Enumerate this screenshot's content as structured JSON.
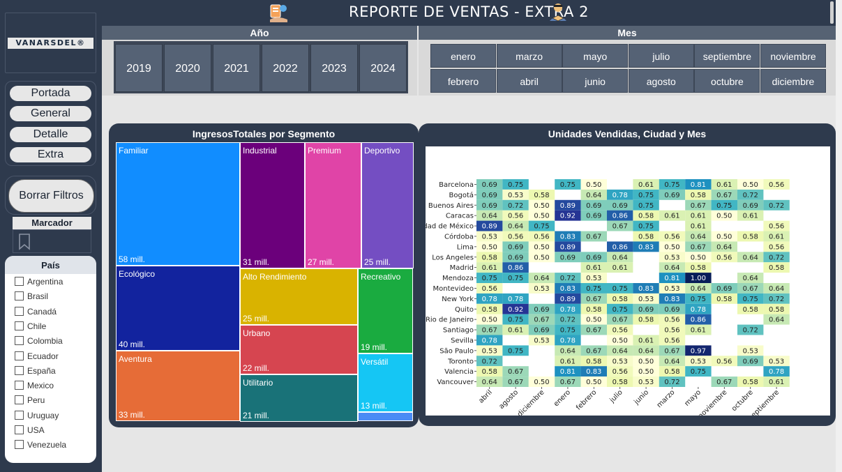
{
  "header": {
    "title": "REPORTE DE VENTAS - EXTRA 2",
    "left_icon": "sales-report-icon",
    "right_icon": "handshake-icon"
  },
  "logo": {
    "text": "VANARSDEL®"
  },
  "nav": {
    "items": [
      {
        "label": "Portada"
      },
      {
        "label": "General"
      },
      {
        "label": "Detalle"
      },
      {
        "label": "Extra"
      }
    ]
  },
  "clear_filters": {
    "label": "Borrar Filtros"
  },
  "bookmark": {
    "title": "Marcador",
    "icon": "bookmark-icon"
  },
  "country_filter": {
    "title": "País",
    "items": [
      "Argentina",
      "Brasil",
      "Canadá",
      "Chile",
      "Colombia",
      "Ecuador",
      "España",
      "Mexico",
      "Peru",
      "Uruguay",
      "USA",
      "Venezuela"
    ]
  },
  "year_slicer": {
    "title": "Año",
    "years": [
      "2019",
      "2020",
      "2021",
      "2022",
      "2023",
      "2024"
    ]
  },
  "month_slicer": {
    "title": "Mes",
    "row1": [
      "enero",
      "marzo",
      "mayo",
      "julio",
      "septiembre",
      "noviembre"
    ],
    "row2": [
      "febrero",
      "abril",
      "junio",
      "agosto",
      "octubre",
      "diciembre"
    ]
  },
  "colors": {
    "panel": "#2e3a4d",
    "slicer_button": "#556275",
    "background": "#e6e6e6"
  },
  "chart_data": [
    {
      "type": "treemap",
      "title": "IngresosTotales por Segmento",
      "unit": "mill.",
      "segments": [
        {
          "name": "Familiar",
          "value": 58,
          "label": "58 mill.",
          "color": "#118dff"
        },
        {
          "name": "Industrial",
          "value": 31,
          "label": "31 mill.",
          "color": "#6b007b"
        },
        {
          "name": "Premium",
          "value": 27,
          "label": "27 mill.",
          "color": "#e044a7"
        },
        {
          "name": "Deportivo",
          "value": 25,
          "label": "25 mill.",
          "color": "#744ec2"
        },
        {
          "name": "Ecológico",
          "value": 40,
          "label": "40 mill.",
          "color": "#12239e"
        },
        {
          "name": "Alto Rendimiento",
          "value": 25,
          "label": "25 mill.",
          "color": "#d9b300"
        },
        {
          "name": "Recreativo",
          "value": 19,
          "label": "19 mill.",
          "color": "#1aab40"
        },
        {
          "name": "Aventura",
          "value": 33,
          "label": "33 mill.",
          "color": "#e66c37"
        },
        {
          "name": "Urbano",
          "value": 22,
          "label": "22 mill.",
          "color": "#d64550"
        },
        {
          "name": "Versátil",
          "value": 13,
          "label": "13 mill.",
          "color": "#15c6f4"
        },
        {
          "name": "Utilitario",
          "value": 21,
          "label": "21 mill.",
          "color": "#197278"
        }
      ]
    },
    {
      "type": "heatmap",
      "title": "Unidades Vendidas, Ciudad y Mes",
      "x": [
        "abril",
        "agosto",
        "diciembre",
        "enero",
        "febrero",
        "julio",
        "junio",
        "marzo",
        "mayo",
        "noviembre",
        "octubre",
        "septiembre"
      ],
      "y": [
        "Barcelona",
        "Bogotá",
        "Buenos Aires",
        "Caracas",
        "Ciudad de México",
        "Córdoba",
        "Lima",
        "Los Angeles",
        "Madrid",
        "Mendoza",
        "Montevideo",
        "New York",
        "Quito",
        "Rio de Janeiro",
        "Santiago",
        "Sevilla",
        "São Paulo",
        "Toronto",
        "Valencia",
        "Vancouver"
      ],
      "values": [
        [
          0.69,
          0.75,
          null,
          0.75,
          0.5,
          null,
          0.61,
          0.75,
          0.81,
          0.61,
          0.5,
          0.56
        ],
        [
          0.69,
          0.53,
          0.58,
          null,
          0.64,
          0.78,
          0.75,
          0.69,
          0.58,
          0.67,
          0.72,
          null
        ],
        [
          0.69,
          0.72,
          0.5,
          0.89,
          0.69,
          0.69,
          0.75,
          null,
          0.67,
          0.75,
          0.69,
          0.72
        ],
        [
          0.64,
          0.56,
          0.5,
          0.92,
          0.69,
          0.86,
          0.58,
          0.61,
          0.61,
          0.5,
          0.61,
          null
        ],
        [
          0.89,
          0.64,
          0.75,
          null,
          null,
          0.67,
          0.75,
          null,
          0.61,
          null,
          null,
          0.56
        ],
        [
          0.53,
          0.56,
          0.56,
          0.83,
          0.67,
          null,
          0.58,
          0.56,
          0.64,
          0.5,
          0.58,
          0.61
        ],
        [
          0.5,
          0.69,
          0.5,
          0.89,
          null,
          0.86,
          0.83,
          0.5,
          0.67,
          0.64,
          null,
          0.56
        ],
        [
          0.58,
          0.69,
          0.5,
          0.69,
          0.69,
          0.64,
          null,
          0.53,
          0.5,
          0.56,
          0.64,
          0.72
        ],
        [
          0.61,
          0.86,
          null,
          null,
          0.61,
          0.61,
          null,
          0.64,
          0.58,
          null,
          null,
          0.58
        ],
        [
          0.75,
          0.75,
          0.64,
          0.72,
          0.53,
          null,
          null,
          0.81,
          1.0,
          null,
          0.64,
          null
        ],
        [
          0.56,
          null,
          0.53,
          0.83,
          0.75,
          0.75,
          0.83,
          0.53,
          0.64,
          0.69,
          0.67,
          0.64
        ],
        [
          0.78,
          0.78,
          null,
          0.89,
          0.67,
          0.58,
          0.53,
          0.83,
          0.75,
          0.58,
          0.75,
          0.72
        ],
        [
          0.58,
          0.92,
          0.69,
          0.78,
          0.58,
          0.75,
          0.69,
          0.69,
          0.78,
          null,
          0.58,
          0.58
        ],
        [
          0.5,
          0.75,
          0.67,
          0.72,
          0.5,
          0.67,
          0.58,
          0.56,
          0.86,
          null,
          null,
          0.64
        ],
        [
          0.67,
          0.61,
          0.69,
          0.75,
          0.67,
          0.56,
          null,
          0.56,
          0.61,
          null,
          0.72,
          null
        ],
        [
          0.78,
          null,
          0.53,
          0.78,
          null,
          0.5,
          0.61,
          0.56,
          null,
          null,
          null,
          null
        ],
        [
          0.53,
          0.75,
          null,
          0.64,
          0.67,
          0.64,
          0.64,
          0.67,
          0.97,
          null,
          0.53,
          null
        ],
        [
          0.72,
          null,
          null,
          0.61,
          0.58,
          0.53,
          0.5,
          0.64,
          0.53,
          0.56,
          0.69,
          0.53
        ],
        [
          0.58,
          0.67,
          null,
          0.81,
          0.83,
          0.56,
          0.5,
          0.58,
          0.75,
          null,
          null,
          0.78
        ],
        [
          0.64,
          0.67,
          0.5,
          0.67,
          0.5,
          0.58,
          0.53,
          0.72,
          null,
          0.67,
          0.58,
          0.61
        ]
      ],
      "colormap": "YlGnBu",
      "vmin": 0.5,
      "vmax": 1.0
    }
  ]
}
